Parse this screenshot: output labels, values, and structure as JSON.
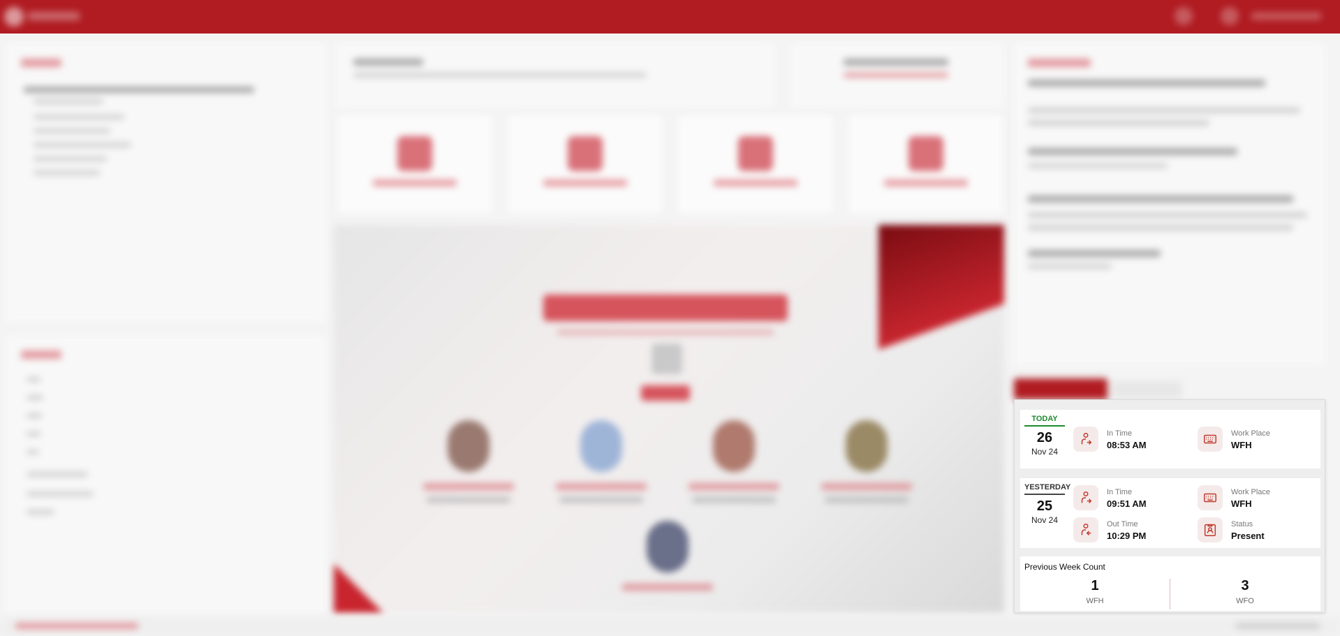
{
  "attendance": {
    "today": {
      "badge": "TODAY",
      "day": "26",
      "month": "Nov 24",
      "in_time_label": "In Time",
      "in_time": "08:53 AM",
      "work_place_label": "Work Place",
      "work_place": "WFH"
    },
    "yesterday": {
      "badge": "YESTERDAY",
      "day": "25",
      "month": "Nov 24",
      "in_time_label": "In Time",
      "in_time": "09:51 AM",
      "work_place_label": "Work Place",
      "work_place": "WFH",
      "out_time_label": "Out Time",
      "out_time": "10:29 PM",
      "status_label": "Status",
      "status": "Present"
    },
    "previous_week": {
      "title": "Previous Week Count",
      "wfh_count": "1",
      "wfh_label": "WFH",
      "wfo_count": "3",
      "wfo_label": "WFO"
    }
  },
  "colors": {
    "brand": "#b01c22",
    "today_accent": "#1e8a2e",
    "icon_bg": "#f5eaea",
    "icon_stroke": "#c0392b"
  },
  "icons": [
    "user-arrive-icon",
    "keyboard-icon",
    "user-leave-icon",
    "id-badge-icon"
  ]
}
